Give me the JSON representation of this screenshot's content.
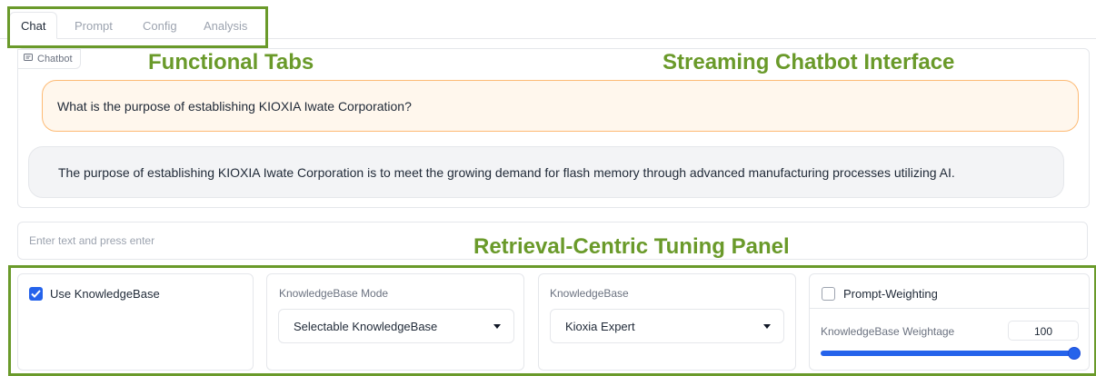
{
  "tabs": [
    {
      "label": "Chat",
      "active": true
    },
    {
      "label": "Prompt",
      "active": false
    },
    {
      "label": "Config",
      "active": false
    },
    {
      "label": "Analysis",
      "active": false
    }
  ],
  "annotations": {
    "functional_tabs": "Functional Tabs",
    "streaming_chatbot": "Streaming Chatbot Interface",
    "retrieval_panel": "Retrieval-Centric Tuning Panel"
  },
  "chatbot": {
    "label": "Chatbot",
    "label_icon": "chat-bubble-icon",
    "user_message": "What is the purpose of establishing KIOXIA Iwate Corporation?",
    "bot_message": "The purpose of establishing KIOXIA Iwate Corporation is to meet the growing demand for flash memory through advanced manufacturing processes utilizing AI."
  },
  "input": {
    "placeholder": "Enter text and press enter",
    "value": ""
  },
  "settings": {
    "use_kb": {
      "label": "Use KnowledgeBase",
      "checked": true
    },
    "kb_mode": {
      "label": "KnowledgeBase Mode",
      "selected": "Selectable KnowledgeBase"
    },
    "kb": {
      "label": "KnowledgeBase",
      "selected": "Kioxia Expert"
    },
    "prompt_weighting": {
      "label": "Prompt-Weighting",
      "checked": false
    },
    "kb_weightage": {
      "label": "KnowledgeBase Weightage",
      "value": "100",
      "slider_fraction": 1.0
    }
  },
  "colors": {
    "annotation_green": "#6a9a2a",
    "accent_blue": "#2563eb",
    "user_bubble_bg": "#fff7ed",
    "user_bubble_border": "#fdba74",
    "bot_bubble_bg": "#f3f4f6"
  }
}
